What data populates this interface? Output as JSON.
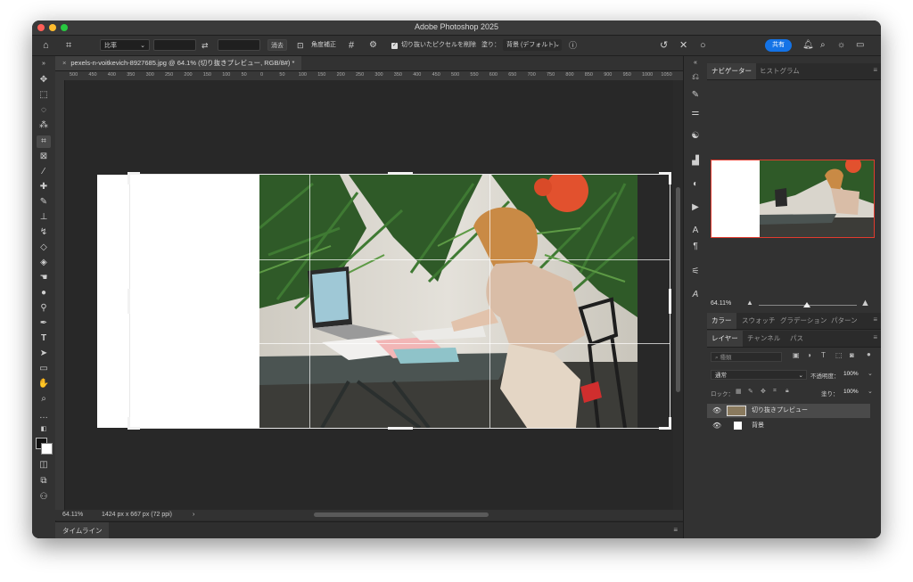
{
  "window": {
    "title": "Adobe Photoshop 2025"
  },
  "options_bar": {
    "ratio": "比率",
    "clear": "消去",
    "straighten": "角度補正",
    "delete_cropped": "切り抜いたピクセルを削除",
    "fill_label": "塗り：",
    "fill_value": "背景 (デフォルト)",
    "share": "共有"
  },
  "document": {
    "tab_title": "pexels-n-voitkevich-8927685.jpg @ 64.1% (切り抜きプレビュー, RGB/8#) *",
    "zoom": "64.11%",
    "dimensions": "1424 px x 667 px (72 ppi)"
  },
  "ruler_top": [
    "500",
    "450",
    "400",
    "350",
    "300",
    "250",
    "200",
    "150",
    "100",
    "50",
    "0",
    "50",
    "100",
    "150",
    "200",
    "250",
    "300",
    "350",
    "400",
    "450",
    "500",
    "550",
    "600",
    "650",
    "700",
    "750",
    "800",
    "850",
    "900",
    "950",
    "1000",
    "1050"
  ],
  "timeline": {
    "tab": "タイムライン"
  },
  "panels": {
    "navigator_tabs": [
      "ナビゲーター",
      "ヒストグラム"
    ],
    "navigator_zoom": "64.11%",
    "color_tabs": [
      "カラー",
      "スウォッチ",
      "グラデーション",
      "パターン"
    ],
    "layer_tabs": [
      "レイヤー",
      "チャンネル",
      "パス"
    ],
    "layer_filter": "種類",
    "blend_mode": "通常",
    "opacity_label": "不透明度：",
    "opacity_value": "100%",
    "lock_label": "ロック：",
    "fill_label": "塗り：",
    "fill_value": "100%",
    "layers": [
      {
        "name": "切り抜きプレビュー",
        "selected": true
      },
      {
        "name": "背景",
        "selected": false
      }
    ]
  },
  "colors": {
    "accent": "#1473e6",
    "app_bg": "#2b2b2b",
    "panel_bg": "#323232",
    "nav_box": "#e23b2e"
  }
}
